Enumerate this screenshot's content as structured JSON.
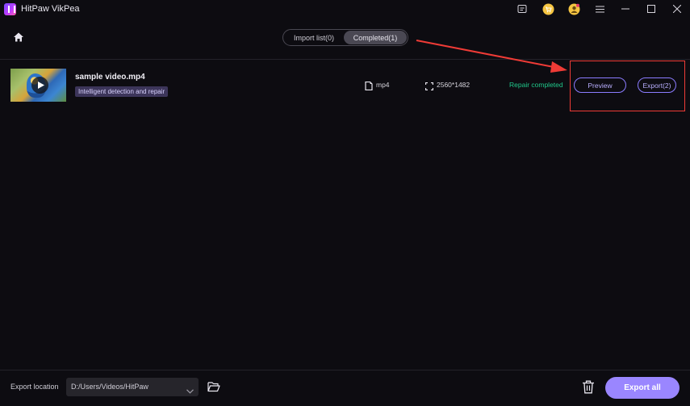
{
  "app": {
    "title": "HitPaw VikPea",
    "logo_color": "#9b4dff"
  },
  "titlebar": {
    "icons": [
      "feedback-icon",
      "cart-icon",
      "account-icon",
      "menu-icon",
      "minimize-icon",
      "maximize-icon",
      "close-icon"
    ]
  },
  "header": {
    "home_icon": "home-icon",
    "tabs": [
      {
        "label": "Import list(0)",
        "active": false
      },
      {
        "label": "Completed(1)",
        "active": true
      }
    ]
  },
  "files": [
    {
      "name": "sample video.mp4",
      "tag": "Intelligent detection and repair",
      "format": "mp4",
      "resolution": "2560*1482",
      "status": "Repair completed",
      "status_color": "#20c98b",
      "preview_label": "Preview",
      "export_label": "Export(2)"
    }
  ],
  "footer": {
    "export_location_label": "Export location",
    "export_path": "D:/Users/Videos/HitPaw",
    "export_all_label": "Export all"
  },
  "colors": {
    "accent": "#9a86ff",
    "background": "#0d0c11",
    "annotation": "#ef3b36"
  }
}
